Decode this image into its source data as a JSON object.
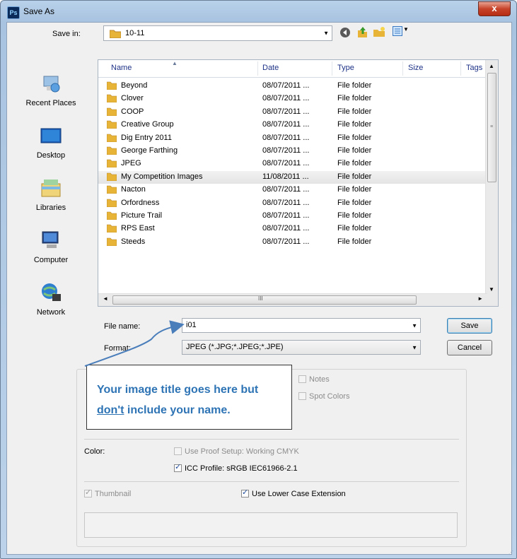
{
  "window": {
    "title": "Save As",
    "app_icon": "Ps",
    "close_symbol": "x"
  },
  "save_in": {
    "label": "Save in:",
    "value": "10-11"
  },
  "places": [
    {
      "label": "Recent Places",
      "icon": "recent-places-icon"
    },
    {
      "label": "Desktop",
      "icon": "desktop-icon"
    },
    {
      "label": "Libraries",
      "icon": "libraries-icon"
    },
    {
      "label": "Computer",
      "icon": "computer-icon"
    },
    {
      "label": "Network",
      "icon": "network-icon"
    }
  ],
  "columns": [
    "Name",
    "Date",
    "Type",
    "Size",
    "Tags"
  ],
  "files": [
    {
      "name": "Beyond",
      "date": "08/07/2011 ...",
      "type": "File folder"
    },
    {
      "name": "Clover",
      "date": "08/07/2011 ...",
      "type": "File folder"
    },
    {
      "name": "COOP",
      "date": "08/07/2011 ...",
      "type": "File folder"
    },
    {
      "name": "Creative Group",
      "date": "08/07/2011 ...",
      "type": "File folder"
    },
    {
      "name": "Dig Entry 2011",
      "date": "08/07/2011 ...",
      "type": "File folder"
    },
    {
      "name": "George Farthing",
      "date": "08/07/2011 ...",
      "type": "File folder"
    },
    {
      "name": "JPEG",
      "date": "08/07/2011 ...",
      "type": "File folder"
    },
    {
      "name": "My Competition Images",
      "date": "11/08/2011 ...",
      "type": "File folder",
      "selected": true
    },
    {
      "name": "Nacton",
      "date": "08/07/2011 ...",
      "type": "File folder"
    },
    {
      "name": "Orfordness",
      "date": "08/07/2011 ...",
      "type": "File folder"
    },
    {
      "name": "Picture Trail",
      "date": "08/07/2011 ...",
      "type": "File folder"
    },
    {
      "name": "RPS East",
      "date": "08/07/2011 ...",
      "type": "File folder"
    },
    {
      "name": "Steeds",
      "date": "08/07/2011 ...",
      "type": "File folder"
    }
  ],
  "hscroll_grip": "III",
  "file_name": {
    "label": "File name:",
    "value": "i01"
  },
  "format": {
    "label": "Format:",
    "value": "JPEG (*.JPG;*.JPEG;*.JPE)"
  },
  "buttons": {
    "save": "Save",
    "cancel": "Cancel"
  },
  "options": {
    "notes": "Notes",
    "spot_colors": "Spot Colors",
    "color_label": "Color:",
    "use_proof_setup": "Use Proof Setup:  Working CMYK",
    "icc_profile": "ICC Profile:  sRGB IEC61966-2.1",
    "thumbnail": "Thumbnail",
    "lower_case_ext": "Use Lower Case Extension"
  },
  "callout": {
    "line1": "Your image title goes here but",
    "line2_underlined": "don't",
    "line2_rest": " include your name."
  },
  "colors": {
    "callout_text": "#2e74b5",
    "arrow": "#4a7ebb",
    "selection": "#e8e8e8"
  }
}
